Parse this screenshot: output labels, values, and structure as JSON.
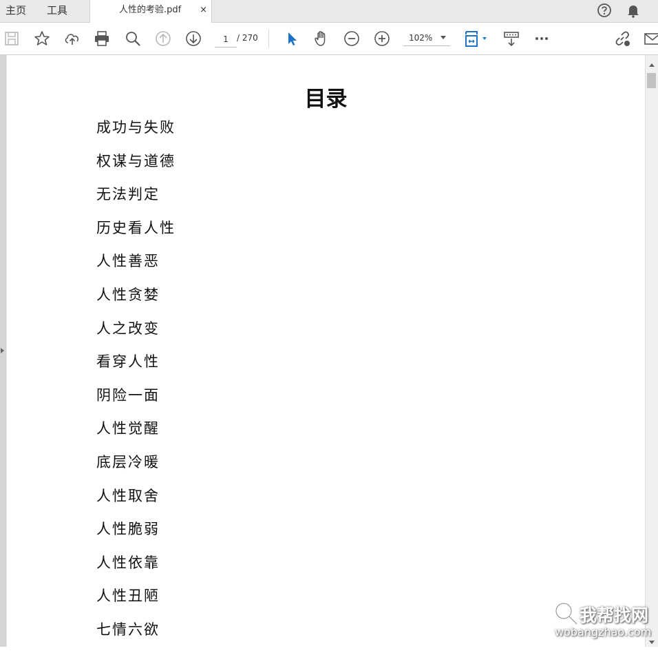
{
  "nav": {
    "home": "主页",
    "tools": "工具"
  },
  "tab": {
    "filename": "人性的考验.pdf",
    "close": "×"
  },
  "top_icons": [
    "help-icon",
    "bell-icon"
  ],
  "toolbar": {
    "icons": [
      "save-icon",
      "star-icon",
      "cloud-upload-icon",
      "print-icon",
      "zoom-search-icon",
      "arrow-up-circle-icon",
      "arrow-down-circle-icon",
      "cursor-icon",
      "hand-icon",
      "zoom-out-icon",
      "zoom-in-icon",
      "fit-page-icon",
      "read-mode-icon",
      "more-icon",
      "link-icon",
      "mail-icon"
    ],
    "page_current": "1",
    "page_total": "/ 270",
    "zoom": "102%"
  },
  "document": {
    "title": "目录",
    "toc": [
      "成功与失败",
      "权谋与道德",
      "无法判定",
      "历史看人性",
      "人性善恶",
      "人性贪婪",
      "人之改变",
      "看穿人性",
      "阴险一面",
      "人性觉醒",
      "底层冷暖",
      "人性取舍",
      "人性脆弱",
      "人性依靠",
      "人性丑陋",
      "七情六欲"
    ]
  },
  "watermark": {
    "main": "我帮找网",
    "sub": "wobangzhao.com"
  },
  "colors": {
    "accent": "#1a73c7",
    "icon": "#555555",
    "disabled": "#b8b8b8"
  }
}
